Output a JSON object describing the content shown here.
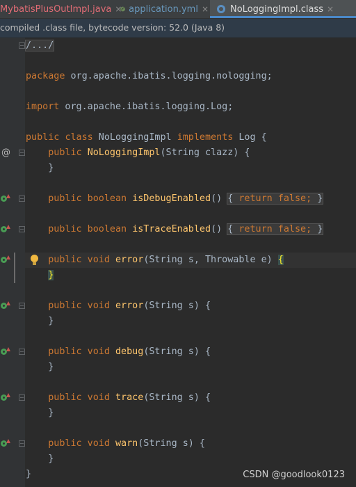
{
  "tabs": [
    {
      "label": "MybatisPlusOutImpl.java",
      "icon": "java-class-icon",
      "close": "×"
    },
    {
      "label": "application.yml",
      "icon": "yaml-leaf-icon",
      "close": "×"
    },
    {
      "label": "NoLoggingImpl.class",
      "icon": "class-file-icon",
      "close": "×"
    }
  ],
  "banner": {
    "text": "compiled .class file, bytecode version: 52.0 (Java 8)"
  },
  "code": {
    "comment": "/.../",
    "package_kw": "package",
    "package_name": " org.apache.ibatis.logging.nologging;",
    "import_kw": "import",
    "import_name": " org.apache.ibatis.logging.Log;",
    "class_kw1": "public",
    "class_kw2": "class",
    "class_name": " NoLoggingImpl ",
    "implements_kw": "implements",
    "iface": " Log {",
    "ctor_kw": "public",
    "ctor_name": "NoLoggingImpl",
    "ctor_rest": "(String clazz) {",
    "close_brace": "}",
    "debug_kw": "public boolean",
    "debug_name": "isDebugEnabled",
    "debug_rest": "() ",
    "folded_body": "{ return false; }",
    "folded_open": "{",
    "folded_return": "return false;",
    "folded_close": "}",
    "trace_enabled_name": "isTraceEnabled",
    "void_kw": "public void",
    "error_name": "error",
    "error1_rest": "(String s, Throwable e) ",
    "open_brace": "{",
    "error2_rest": "(String s) {",
    "debug_m_name": "debug",
    "debug_m_rest": "(String s) {",
    "trace_name": "trace",
    "trace_rest": "(String s) {",
    "warn_name": "warn",
    "warn_rest": "(String s) {"
  },
  "gutter": {
    "at_symbol": "@"
  },
  "watermark": "CSDN @goodlook0123"
}
